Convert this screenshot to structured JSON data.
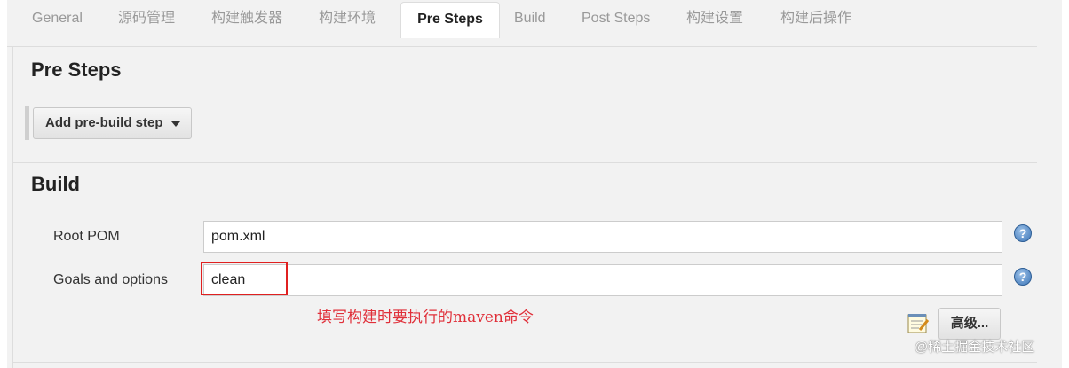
{
  "tabs": [
    {
      "label": "General",
      "active": false
    },
    {
      "label": "源码管理",
      "active": false
    },
    {
      "label": "构建触发器",
      "active": false
    },
    {
      "label": "构建环境",
      "active": false
    },
    {
      "label": "Pre Steps",
      "active": true
    },
    {
      "label": "Build",
      "active": false
    },
    {
      "label": "Post Steps",
      "active": false
    },
    {
      "label": "构建设置",
      "active": false
    },
    {
      "label": "构建后操作",
      "active": false
    }
  ],
  "pre_steps": {
    "title": "Pre Steps",
    "add_button_label": "Add pre-build step"
  },
  "build": {
    "title": "Build",
    "root_pom": {
      "label": "Root POM",
      "value": "pom.xml"
    },
    "goals": {
      "label": "Goals and options",
      "value": "clean"
    },
    "advanced_label": "高级..."
  },
  "annotation": "填写构建时要执行的maven命令",
  "watermark": "@稀土掘金技术社区",
  "colors": {
    "highlight": "#e02020",
    "annotation": "#e0303a",
    "panel_bg": "#f2f2f2"
  }
}
